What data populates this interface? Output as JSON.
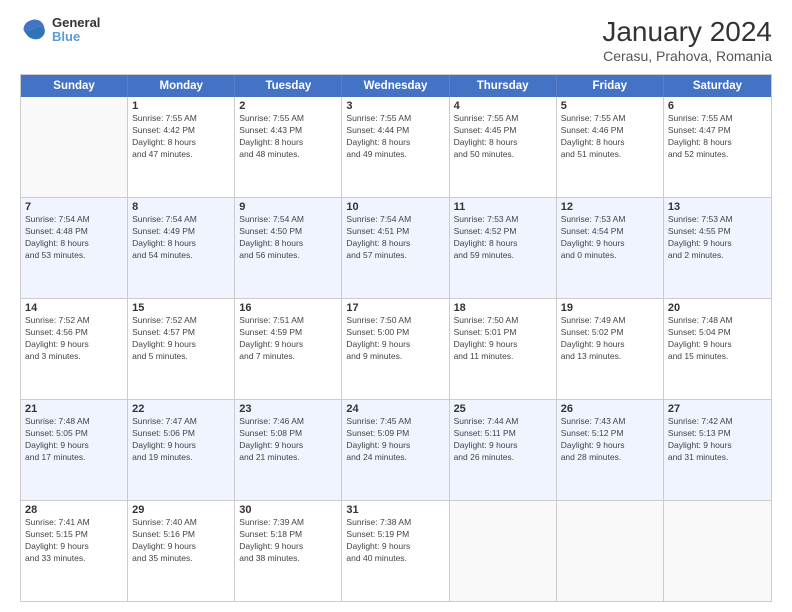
{
  "header": {
    "logo_line1": "General",
    "logo_line2": "Blue",
    "title": "January 2024",
    "subtitle": "Cerasu, Prahova, Romania"
  },
  "calendar": {
    "weekdays": [
      "Sunday",
      "Monday",
      "Tuesday",
      "Wednesday",
      "Thursday",
      "Friday",
      "Saturday"
    ],
    "rows": [
      [
        {
          "day": "",
          "info": ""
        },
        {
          "day": "1",
          "info": "Sunrise: 7:55 AM\nSunset: 4:42 PM\nDaylight: 8 hours\nand 47 minutes."
        },
        {
          "day": "2",
          "info": "Sunrise: 7:55 AM\nSunset: 4:43 PM\nDaylight: 8 hours\nand 48 minutes."
        },
        {
          "day": "3",
          "info": "Sunrise: 7:55 AM\nSunset: 4:44 PM\nDaylight: 8 hours\nand 49 minutes."
        },
        {
          "day": "4",
          "info": "Sunrise: 7:55 AM\nSunset: 4:45 PM\nDaylight: 8 hours\nand 50 minutes."
        },
        {
          "day": "5",
          "info": "Sunrise: 7:55 AM\nSunset: 4:46 PM\nDaylight: 8 hours\nand 51 minutes."
        },
        {
          "day": "6",
          "info": "Sunrise: 7:55 AM\nSunset: 4:47 PM\nDaylight: 8 hours\nand 52 minutes."
        }
      ],
      [
        {
          "day": "7",
          "info": "Sunrise: 7:54 AM\nSunset: 4:48 PM\nDaylight: 8 hours\nand 53 minutes."
        },
        {
          "day": "8",
          "info": "Sunrise: 7:54 AM\nSunset: 4:49 PM\nDaylight: 8 hours\nand 54 minutes."
        },
        {
          "day": "9",
          "info": "Sunrise: 7:54 AM\nSunset: 4:50 PM\nDaylight: 8 hours\nand 56 minutes."
        },
        {
          "day": "10",
          "info": "Sunrise: 7:54 AM\nSunset: 4:51 PM\nDaylight: 8 hours\nand 57 minutes."
        },
        {
          "day": "11",
          "info": "Sunrise: 7:53 AM\nSunset: 4:52 PM\nDaylight: 8 hours\nand 59 minutes."
        },
        {
          "day": "12",
          "info": "Sunrise: 7:53 AM\nSunset: 4:54 PM\nDaylight: 9 hours\nand 0 minutes."
        },
        {
          "day": "13",
          "info": "Sunrise: 7:53 AM\nSunset: 4:55 PM\nDaylight: 9 hours\nand 2 minutes."
        }
      ],
      [
        {
          "day": "14",
          "info": "Sunrise: 7:52 AM\nSunset: 4:56 PM\nDaylight: 9 hours\nand 3 minutes."
        },
        {
          "day": "15",
          "info": "Sunrise: 7:52 AM\nSunset: 4:57 PM\nDaylight: 9 hours\nand 5 minutes."
        },
        {
          "day": "16",
          "info": "Sunrise: 7:51 AM\nSunset: 4:59 PM\nDaylight: 9 hours\nand 7 minutes."
        },
        {
          "day": "17",
          "info": "Sunrise: 7:50 AM\nSunset: 5:00 PM\nDaylight: 9 hours\nand 9 minutes."
        },
        {
          "day": "18",
          "info": "Sunrise: 7:50 AM\nSunset: 5:01 PM\nDaylight: 9 hours\nand 11 minutes."
        },
        {
          "day": "19",
          "info": "Sunrise: 7:49 AM\nSunset: 5:02 PM\nDaylight: 9 hours\nand 13 minutes."
        },
        {
          "day": "20",
          "info": "Sunrise: 7:48 AM\nSunset: 5:04 PM\nDaylight: 9 hours\nand 15 minutes."
        }
      ],
      [
        {
          "day": "21",
          "info": "Sunrise: 7:48 AM\nSunset: 5:05 PM\nDaylight: 9 hours\nand 17 minutes."
        },
        {
          "day": "22",
          "info": "Sunrise: 7:47 AM\nSunset: 5:06 PM\nDaylight: 9 hours\nand 19 minutes."
        },
        {
          "day": "23",
          "info": "Sunrise: 7:46 AM\nSunset: 5:08 PM\nDaylight: 9 hours\nand 21 minutes."
        },
        {
          "day": "24",
          "info": "Sunrise: 7:45 AM\nSunset: 5:09 PM\nDaylight: 9 hours\nand 24 minutes."
        },
        {
          "day": "25",
          "info": "Sunrise: 7:44 AM\nSunset: 5:11 PM\nDaylight: 9 hours\nand 26 minutes."
        },
        {
          "day": "26",
          "info": "Sunrise: 7:43 AM\nSunset: 5:12 PM\nDaylight: 9 hours\nand 28 minutes."
        },
        {
          "day": "27",
          "info": "Sunrise: 7:42 AM\nSunset: 5:13 PM\nDaylight: 9 hours\nand 31 minutes."
        }
      ],
      [
        {
          "day": "28",
          "info": "Sunrise: 7:41 AM\nSunset: 5:15 PM\nDaylight: 9 hours\nand 33 minutes."
        },
        {
          "day": "29",
          "info": "Sunrise: 7:40 AM\nSunset: 5:16 PM\nDaylight: 9 hours\nand 35 minutes."
        },
        {
          "day": "30",
          "info": "Sunrise: 7:39 AM\nSunset: 5:18 PM\nDaylight: 9 hours\nand 38 minutes."
        },
        {
          "day": "31",
          "info": "Sunrise: 7:38 AM\nSunset: 5:19 PM\nDaylight: 9 hours\nand 40 minutes."
        },
        {
          "day": "",
          "info": ""
        },
        {
          "day": "",
          "info": ""
        },
        {
          "day": "",
          "info": ""
        }
      ]
    ]
  }
}
